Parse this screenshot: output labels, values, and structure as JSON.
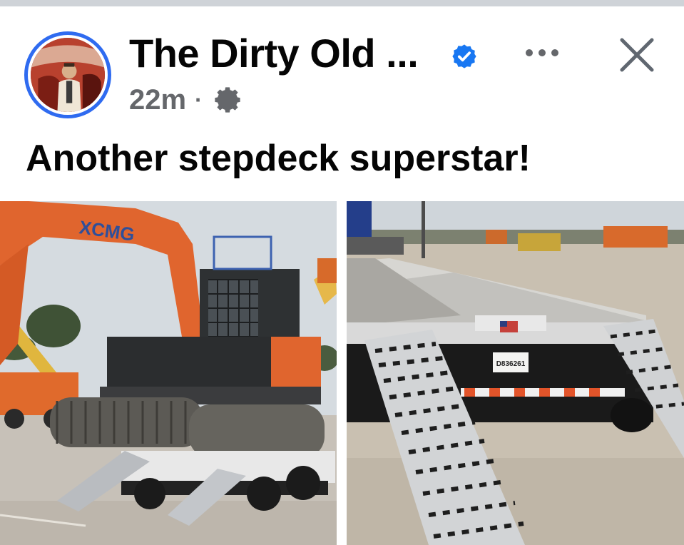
{
  "post": {
    "page_name": "The Dirty Old ...",
    "timestamp": "22m",
    "separator": "·",
    "text": "Another stepdeck superstar!",
    "verified": true,
    "icons": {
      "verified": "verified-badge-icon",
      "audience": "gear-icon",
      "more": "more-options-icon",
      "close": "close-icon"
    },
    "photos": [
      {
        "name": "excavator-on-stepdeck-photo",
        "brand_text": "XCMG"
      },
      {
        "name": "trailer-ramps-photo",
        "plate_text": "D836261"
      }
    ]
  },
  "colors": {
    "verified_blue": "#1877f2",
    "avatar_ring": "#2f6bf0",
    "meta_gray": "#65676b",
    "text": "#050505"
  }
}
